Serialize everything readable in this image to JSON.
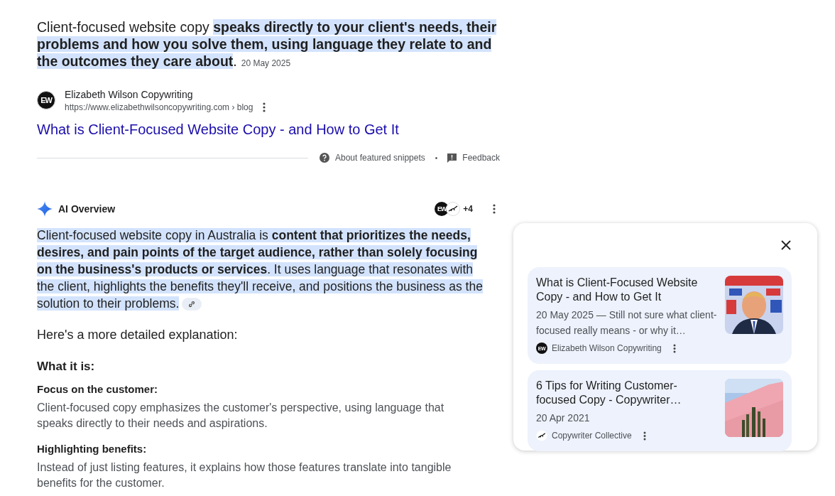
{
  "featured_snippet": {
    "text_plain": "Client-focused website copy",
    "text_highlight": "speaks directly to your client's needs, their problems and how you solve them, using language they relate to and the outcomes they care about",
    "text_end": ".",
    "date": "20 May 2025",
    "source": {
      "favicon_text": "EW",
      "name": "Elizabeth Wilson Copywriting",
      "url": "https://www.elizabethwilsoncopywriting.com › blog"
    },
    "title": "What is Client-Focused Website Copy - and How to Get It",
    "footer": {
      "about": "About featured snippets",
      "separator": "•",
      "feedback": "Feedback"
    }
  },
  "ai_overview": {
    "title": "AI Overview",
    "avatar_text": "EW",
    "source_count": "+4",
    "paragraph": "Client-focused website copy in Australia is **content that prioritizes the needs, desires, and pain points of the target audience, rather than solely focusing on the business's products or services**. It uses language that resonates with the client, highlights the benefits they'll receive, and positions the business as the solution to their problems.",
    "intro": "Here's a more detailed explanation:",
    "items": [
      {
        "kind": "heading",
        "text": "What it is:"
      },
      {
        "kind": "point",
        "title": "Focus on the customer:",
        "body": "Client-focused copy emphasizes the customer's perspective, using language that speaks directly to their needs and aspirations."
      },
      {
        "kind": "point",
        "title": "Highlighting benefits:",
        "body": "Instead of just listing features, it explains how those features translate into tangible benefits for the customer."
      }
    ]
  },
  "sources_panel": {
    "cards": [
      {
        "title": "What is Client-Focused Website Copy - and How to Get It",
        "snippet": "20 May 2025 — Still not sure what client-focused really means - or why it…",
        "favicon": {
          "kind": "monogram",
          "text": "EW"
        },
        "source": "Elizabeth Wilson Copywriting"
      },
      {
        "title": "6 Tips for Writing Customer-focused Copy - Copywriter…",
        "snippet": "20 Apr 2021",
        "favicon": {
          "kind": "insect"
        },
        "source": "Copywriter Collective"
      }
    ]
  }
}
